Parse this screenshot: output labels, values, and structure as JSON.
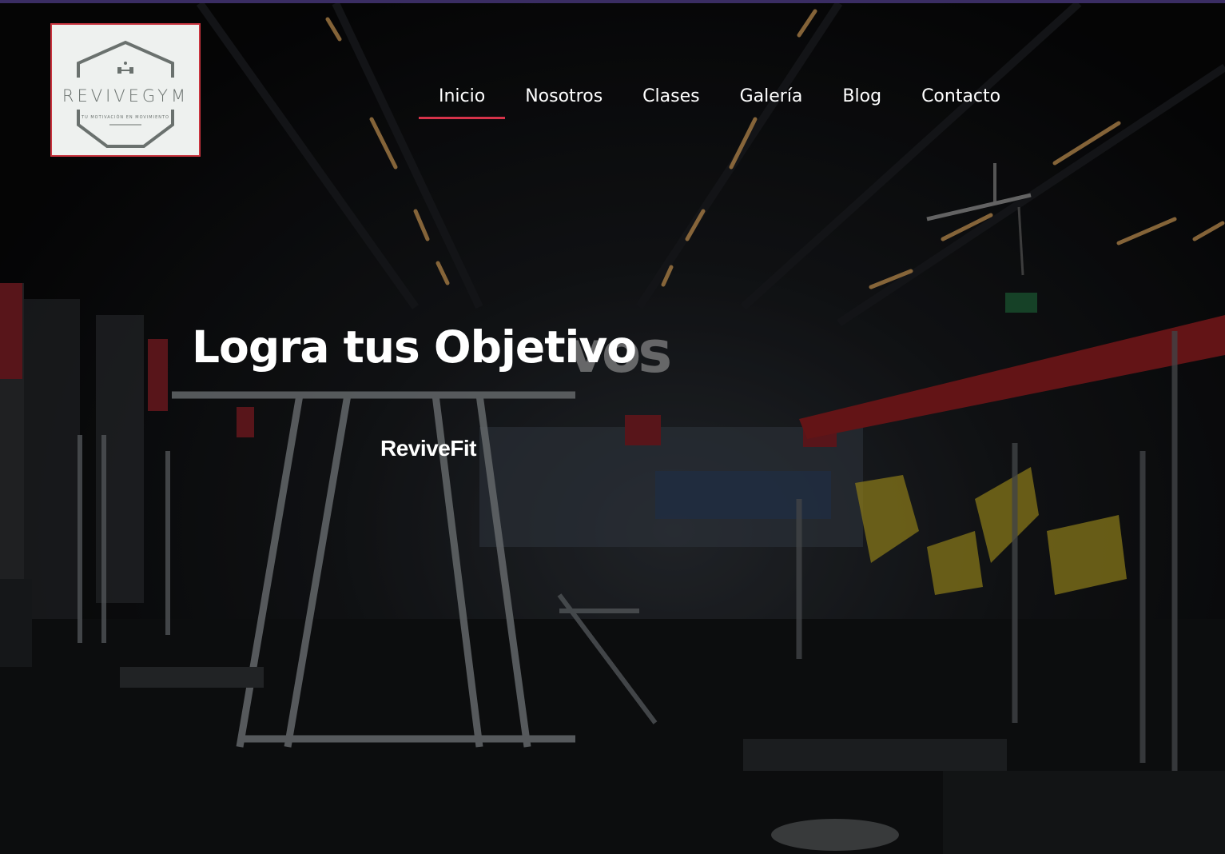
{
  "brand": {
    "logo_word": "REVIVEGYM",
    "logo_tagline": "TU MOTIVACIÓN EN MOVIMIENTO",
    "border_color": "#c9343e"
  },
  "nav": {
    "items": [
      {
        "label": "Inicio",
        "active": true
      },
      {
        "label": "Nosotros",
        "active": false
      },
      {
        "label": "Clases",
        "active": false
      },
      {
        "label": "Galería",
        "active": false
      },
      {
        "label": "Blog",
        "active": false
      },
      {
        "label": "Contacto",
        "active": false
      }
    ],
    "active_underline_color": "#d6334a"
  },
  "hero": {
    "title": "Logra tus Objetivo",
    "ghost_text": "vos",
    "subtitle": "ReviveFit"
  },
  "colors": {
    "top_strip": "#3a2d63",
    "text": "#ffffff"
  }
}
